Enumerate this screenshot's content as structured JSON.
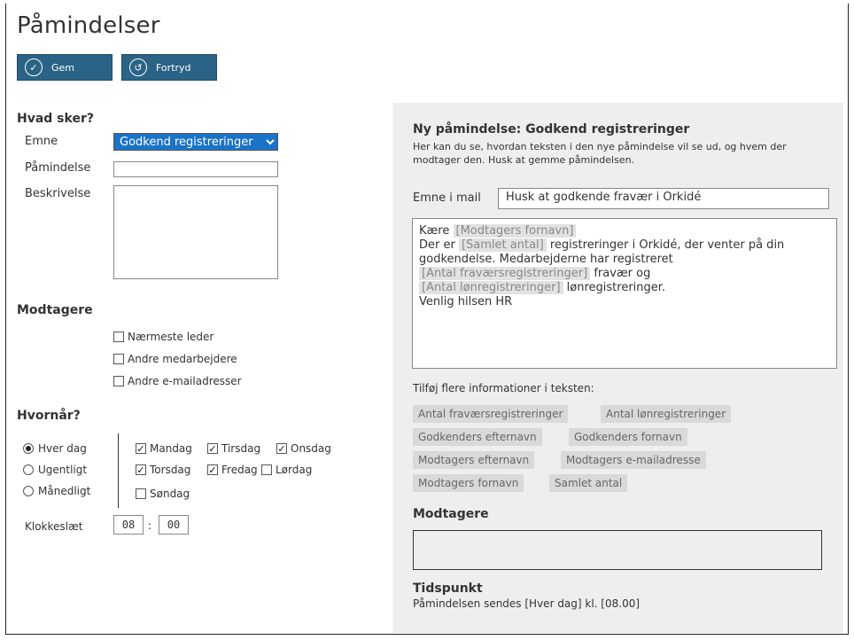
{
  "page": {
    "title": "Påmindelser"
  },
  "toolbar": {
    "save_label": "Gem",
    "undo_label": "Fortryd"
  },
  "form": {
    "what_heading": "Hvad sker?",
    "subject_label": "Emne",
    "subject_value": "Godkend registreringer",
    "reminder_label": "Påmindelse",
    "reminder_value": "",
    "description_label": "Beskrivelse",
    "recipients_heading": "Modtagere",
    "recipients": [
      {
        "label": "Nærmeste leder",
        "checked": false
      },
      {
        "label": "Andre medarbejdere",
        "checked": false
      },
      {
        "label": "Andre e-mailadresser",
        "checked": false
      }
    ],
    "when_heading": "Hvornår?",
    "frequency": [
      {
        "label": "Hver dag",
        "selected": true
      },
      {
        "label": "Ugentligt",
        "selected": false
      },
      {
        "label": "Månedligt",
        "selected": false
      }
    ],
    "days": [
      {
        "label": "Mandag",
        "checked": true
      },
      {
        "label": "Tirsdag",
        "checked": true
      },
      {
        "label": "Onsdag",
        "checked": true
      },
      {
        "label": "Torsdag",
        "checked": true
      },
      {
        "label": "Fredag",
        "checked": true
      },
      {
        "label": "Lørdag",
        "checked": false
      },
      {
        "label": "Søndag",
        "checked": false
      }
    ],
    "time_label": "Klokkeslæt",
    "time_hours": "08",
    "time_sep": ":",
    "time_minutes": "00"
  },
  "preview": {
    "title": "Ny påmindelse: Godkend registreringer",
    "description": "Her kan du se, hvordan teksten i den nye påmindelse vil se ud, og hvem der modtager den. Husk at gemme påmindelsen.",
    "mail_subject_label": "Emne i mail",
    "mail_subject_value": "Husk at godkende fravær i Orkidé",
    "body": {
      "greeting": "Kære",
      "token_first_name": "[Modtagers fornavn]",
      "line2_start": "Der er",
      "token_total": "[Samlet antal]",
      "line2_rest": "registreringer i Orkidé, der venter på din godkendelse. Medarbejderne har registreret",
      "token_absence": "[Antal fraværsregistreringer]",
      "absence_suffix": "fravær og",
      "token_salary": "[Antal lønregistreringer]",
      "salary_suffix": "lønregistreringer.",
      "signature": "Venlig hilsen HR"
    },
    "add_info_label": "Tilføj flere informationer i teksten:",
    "chips": [
      "Antal fraværsregistreringer",
      "Antal lønregistreringer",
      "Godkenders efternavn",
      "Godkenders fornavn",
      "Modtagers efternavn",
      "Modtagers e-mailadresse",
      "Modtagers fornavn",
      "Samlet antal"
    ],
    "recipients_heading": "Modtagere",
    "time_heading": "Tidspunkt",
    "time_text": "Påmindelsen sendes [Hver dag] kl. [08.00]"
  }
}
